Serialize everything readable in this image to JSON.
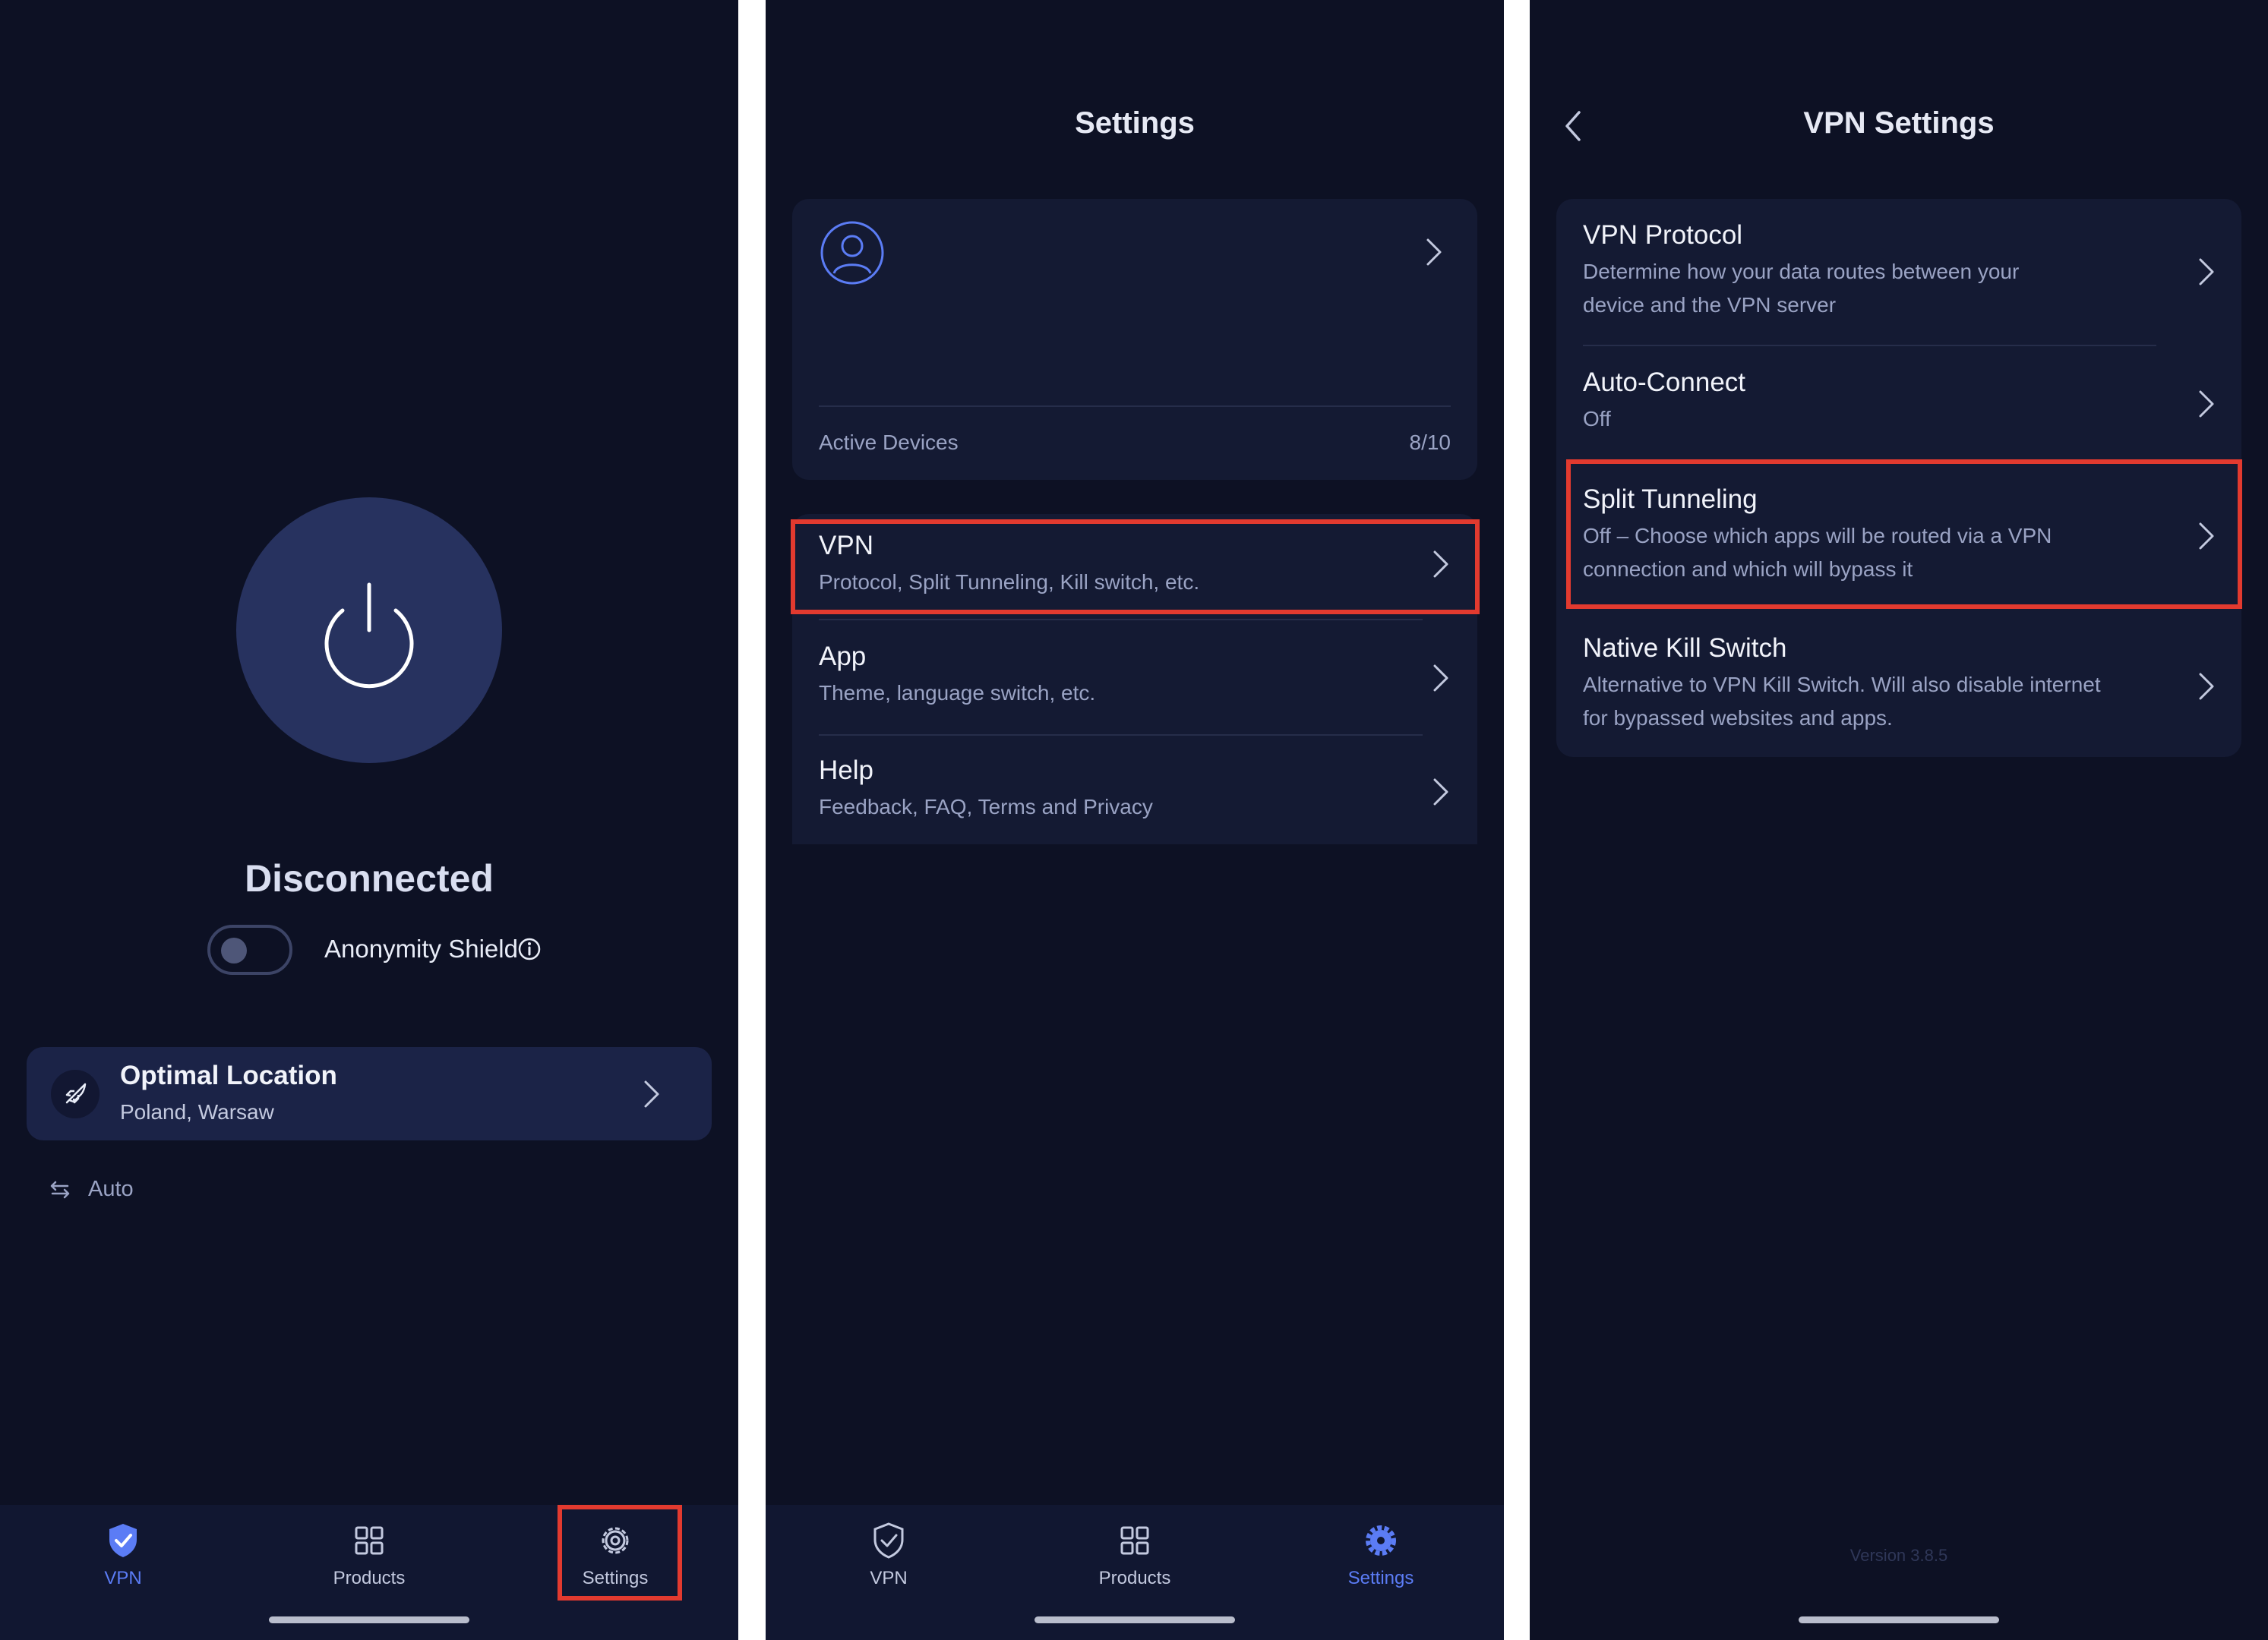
{
  "colors": {
    "background": "#0d1124",
    "card": "#141a33",
    "accent": "#5b7cf5",
    "highlight": "#e23a2f",
    "muted": "#9aa3c4"
  },
  "panel1": {
    "status": "Disconnected",
    "shield_label": "Anonymity Shield",
    "location_title": "Optimal Location",
    "location_sub": "Poland, Warsaw",
    "protocol_mode": "Auto",
    "tabs": {
      "vpn": "VPN",
      "products": "Products",
      "settings": "Settings"
    }
  },
  "panel2": {
    "title": "Settings",
    "active_devices_label": "Active Devices",
    "active_devices_value": "8/10",
    "items": [
      {
        "title": "VPN",
        "subtitle": "Protocol, Split Tunneling, Kill switch, etc."
      },
      {
        "title": "App",
        "subtitle": "Theme, language switch, etc."
      },
      {
        "title": "Help",
        "subtitle": "Feedback, FAQ, Terms and Privacy"
      }
    ],
    "tabs": {
      "vpn": "VPN",
      "products": "Products",
      "settings": "Settings"
    }
  },
  "panel3": {
    "title": "VPN Settings",
    "items": [
      {
        "title": "VPN Protocol",
        "subtitle": "Determine how your data routes between your device and the VPN server"
      },
      {
        "title": "Auto-Connect",
        "subtitle": "Off"
      },
      {
        "title": "Split Tunneling",
        "subtitle": "Off – Choose which apps will be routed via a VPN connection and which will bypass it"
      },
      {
        "title": "Native Kill Switch",
        "subtitle": "Alternative to VPN Kill Switch. Will also disable internet for bypassed websites and apps."
      }
    ],
    "version": "Version 3.8.5"
  }
}
